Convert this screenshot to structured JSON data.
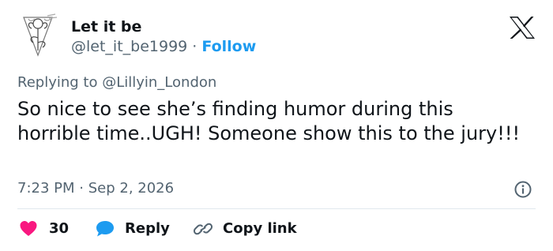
{
  "author": {
    "display_name": "Let it be",
    "handle": "@let_it_be1999",
    "separator": "·",
    "follow_label": "Follow",
    "avatar_icon": "line-art-flower-avatar"
  },
  "brand": {
    "logo_icon": "x-logo",
    "color": "#0f1419"
  },
  "reply": {
    "prefix": "Replying to",
    "target": "@Lillyin_London"
  },
  "tweet": {
    "text": "So nice to see she’s finding humor during this horrible time..UGH! Someone show this to the jury!!!"
  },
  "meta": {
    "time": "7:23 PM",
    "separator": "·",
    "date": "Sep 2, 2026",
    "info_icon": "info-icon"
  },
  "actions": {
    "like": {
      "icon": "heart-icon",
      "count": "30",
      "color": "#f91880"
    },
    "reply": {
      "icon": "speech-bubble-icon",
      "label": "Reply",
      "color": "#1d9bf0"
    },
    "copy": {
      "icon": "link-icon",
      "label": "Copy link"
    }
  },
  "colors": {
    "accent": "#1d9bf0",
    "secondary_text": "#536471",
    "divider": "#e1e8ed"
  }
}
